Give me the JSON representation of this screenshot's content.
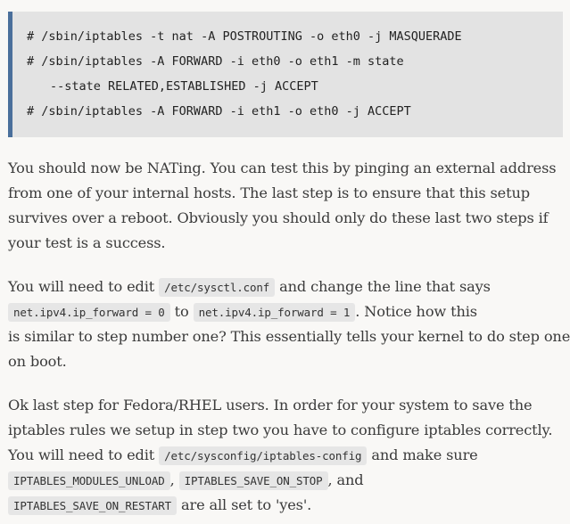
{
  "code_block": {
    "lines": [
      "# /sbin/iptables -t nat -A POSTROUTING -o eth0 -j MASQUERADE",
      "# /sbin/iptables -A FORWARD -i eth0 -o eth1 -m state",
      "--state RELATED,ESTABLISHED -j ACCEPT",
      "# /sbin/iptables -A FORWARD -i eth1 -o eth0 -j ACCEPT"
    ]
  },
  "paragraph1": {
    "lines": [
      "You should now be NATing. You can test this by pinging an external address",
      "from one of your internal hosts. The last step is to ensure that this setup",
      "survives over a reboot. Obviously you should only do these last two steps if",
      "your test is a success."
    ]
  },
  "paragraph2": {
    "t1": "You will need to edit ",
    "c1": "/etc/sysctl.conf",
    "t2": " and change the line that says",
    "c2": "net.ipv4.ip_forward = 0",
    "t3": " to ",
    "c3": "net.ipv4.ip_forward = 1",
    "t4": ". Notice how this",
    "t5": "is similar to step number one? This essentially tells your kernel to do step one",
    "t6": "on boot."
  },
  "paragraph3": {
    "t1": "Ok last step for Fedora/RHEL users. In order for your system to save the",
    "t2": "iptables rules we setup in step two you have to configure iptables correctly.",
    "t3": "You will need to edit ",
    "c1": "/etc/sysconfig/iptables-config",
    "t4": " and make sure",
    "c2": "IPTABLES_MODULES_UNLOAD",
    "t5": ", ",
    "c3": "IPTABLES_SAVE_ON_STOP",
    "t6": ", and",
    "c4": "IPTABLES_SAVE_ON_RESTART",
    "t7": " are all set to 'yes'."
  }
}
